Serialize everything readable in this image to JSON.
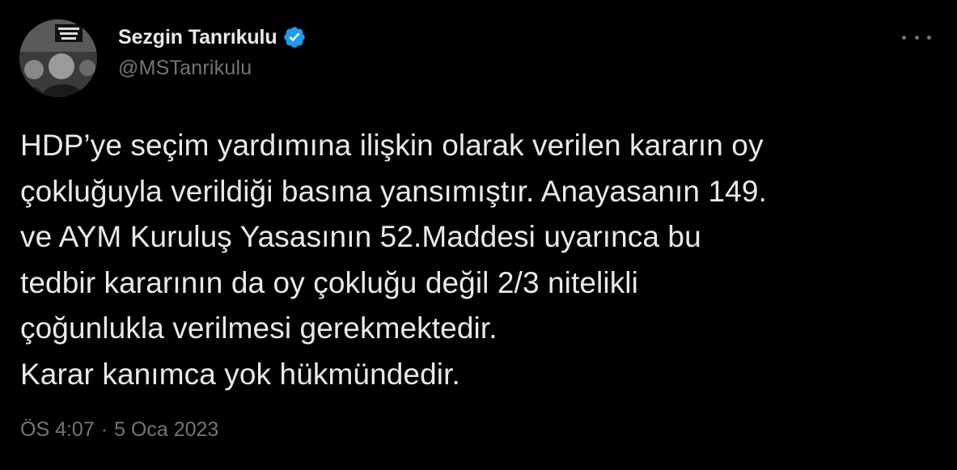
{
  "tweet": {
    "author": {
      "display_name": "Sezgin Tanrıkulu",
      "handle": "@MSTanrikulu",
      "verified_icon": "verified-badge-icon",
      "avatar_icon": "profile-photo"
    },
    "more_icon": "more-options-icon",
    "text": "HDP’ye seçim yardımına ilişkin olarak verilen kararın oy\nçokluğuyla verildiği basına yansımıştır. Anayasanın 149.\nve AYM Kuruluş Yasasının 52.Maddesi uyarınca bu\ntedbir kararının da oy çokluğu değil 2/3 nitelikli\nçoğunlukla verilmesi gerekmektedir.\nKarar kanımca yok hükmündedir.",
    "time": "ÖS 4:07",
    "separator": "·",
    "date": "5 Oca 2023"
  },
  "colors": {
    "background": "#000000",
    "primary_text": "#e7e9ea",
    "secondary_text": "#71767b",
    "verified_blue": "#1d9bf0"
  }
}
